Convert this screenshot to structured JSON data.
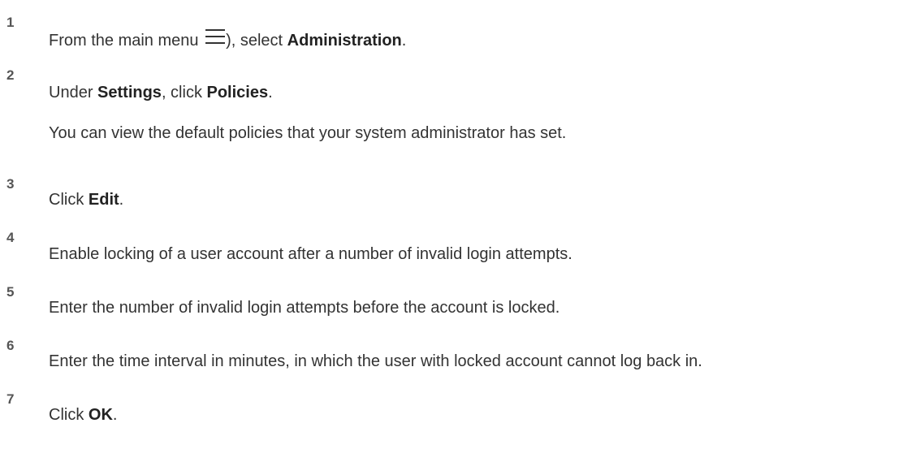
{
  "steps": [
    {
      "number": "1",
      "before": "From the main menu ",
      "icon": "hamburger-menu-icon",
      "after_icon": "), select ",
      "bold": "Administration",
      "end": "."
    },
    {
      "number": "2",
      "before": "Under ",
      "bold1": "Settings",
      "middle": ", click ",
      "bold2": "Policies",
      "end": ".",
      "note": "You can view the default policies that your system administrator has set."
    },
    {
      "number": "3",
      "before": "Click ",
      "bold": "Edit",
      "end": "."
    },
    {
      "number": "4",
      "text": "Enable locking of a user account after a number of invalid login attempts."
    },
    {
      "number": "5",
      "text": "Enter the number of invalid login attempts before the account is locked."
    },
    {
      "number": "6",
      "text": "Enter the time interval in minutes, in which the user with locked account cannot log back in."
    },
    {
      "number": "7",
      "before": "Click ",
      "bold": "OK",
      "end": "."
    }
  ]
}
